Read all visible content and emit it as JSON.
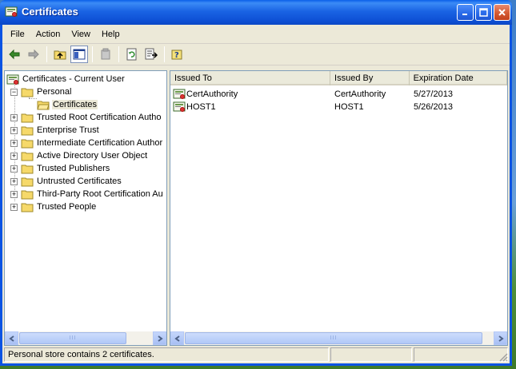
{
  "window": {
    "title": "Certificates"
  },
  "menu": [
    "File",
    "Action",
    "View",
    "Help"
  ],
  "tree": {
    "root": "Certificates - Current User",
    "nodes": [
      {
        "label": "Personal",
        "expanded": true
      },
      {
        "label": "Certificates",
        "child": true,
        "selected": true
      },
      {
        "label": "Trusted Root Certification Autho"
      },
      {
        "label": "Enterprise Trust"
      },
      {
        "label": "Intermediate Certification Author"
      },
      {
        "label": "Active Directory User Object"
      },
      {
        "label": "Trusted Publishers"
      },
      {
        "label": "Untrusted Certificates"
      },
      {
        "label": "Third-Party Root Certification Au"
      },
      {
        "label": "Trusted People"
      }
    ]
  },
  "list": {
    "columns": [
      "Issued To",
      "Issued By",
      "Expiration Date"
    ],
    "rows": [
      {
        "issued_to": "CertAuthority",
        "issued_by": "CertAuthority",
        "expires": "5/27/2013"
      },
      {
        "issued_to": "HOST1",
        "issued_by": "HOST1",
        "expires": "5/26/2013"
      }
    ]
  },
  "status": {
    "text": "Personal store contains 2 certificates."
  },
  "scroll_grip": "III",
  "colors": {
    "title_blue": "#0b54e3",
    "face": "#ece9d8",
    "close_red": "#d55a32"
  },
  "icons": [
    "cert-store-icon",
    "back-arrow-icon",
    "forward-arrow-icon",
    "up-folder-icon",
    "show-hide-tree-icon",
    "delete-icon",
    "refresh-icon",
    "export-list-icon",
    "help-icon",
    "folder-icon",
    "certificate-icon"
  ]
}
